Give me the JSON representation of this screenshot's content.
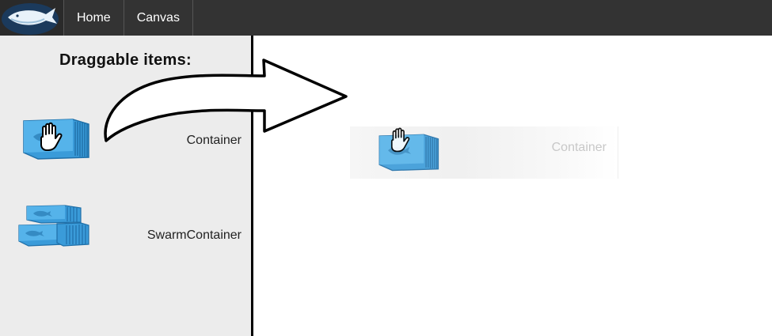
{
  "navbar": {
    "logo_icon": "whale-logo-icon",
    "links": [
      {
        "label": "Home"
      },
      {
        "label": "Canvas"
      }
    ]
  },
  "sidebar": {
    "title": "Draggable items:",
    "items": [
      {
        "label": "Container",
        "icon": "container-icon"
      },
      {
        "label": "SwarmContainer",
        "icon": "swarm-container-icon"
      }
    ]
  },
  "canvas": {
    "drag_ghost": {
      "label": "Container",
      "icon": "container-icon"
    }
  },
  "colors": {
    "navbar_bg": "#333333",
    "sidebar_bg": "#ececec",
    "container_blue": "#3a9bd9",
    "container_dark": "#1f6fa8"
  }
}
